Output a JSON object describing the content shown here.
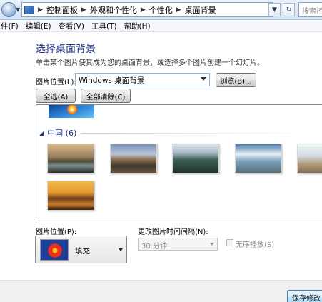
{
  "address_bar": {
    "breadcrumbs": [
      "控制面板",
      "外观和个性化",
      "个性化",
      "桌面背景"
    ],
    "search_placeholder": "搜索控制..."
  },
  "menu": {
    "items": [
      "件(F)",
      "编辑(E)",
      "查看(V)",
      "工具(T)",
      "帮助(H)"
    ]
  },
  "main": {
    "title": "选择桌面背景",
    "subtitle": "单击某个图片使其成为您的桌面背景，或选择多个图片创建一个幻灯片。",
    "picture_location_label": "图片位置(L):",
    "picture_location_value": "Windows 桌面背景",
    "browse_button": "浏览(B)...",
    "select_all_button": "全选(A)",
    "clear_all_button": "全部清除(C)"
  },
  "gallery": {
    "group_title": "中国 (6)",
    "thumbnails": [
      "guilin-river",
      "great-wall",
      "huangshan-peaks",
      "terraced-mountains",
      "beach-rocks",
      "seventeen-arch-bridge"
    ]
  },
  "bottom": {
    "picture_position_label": "图片位置(P):",
    "picture_position_value": "填充",
    "interval_label": "更改图片时间间隔(N):",
    "interval_value": "30 分钟",
    "shuffle_label": "无序播放(S)"
  },
  "footer": {
    "save_button": "保存修改"
  },
  "colors": {
    "title": "#1e3287",
    "group_header": "#1e3287"
  }
}
